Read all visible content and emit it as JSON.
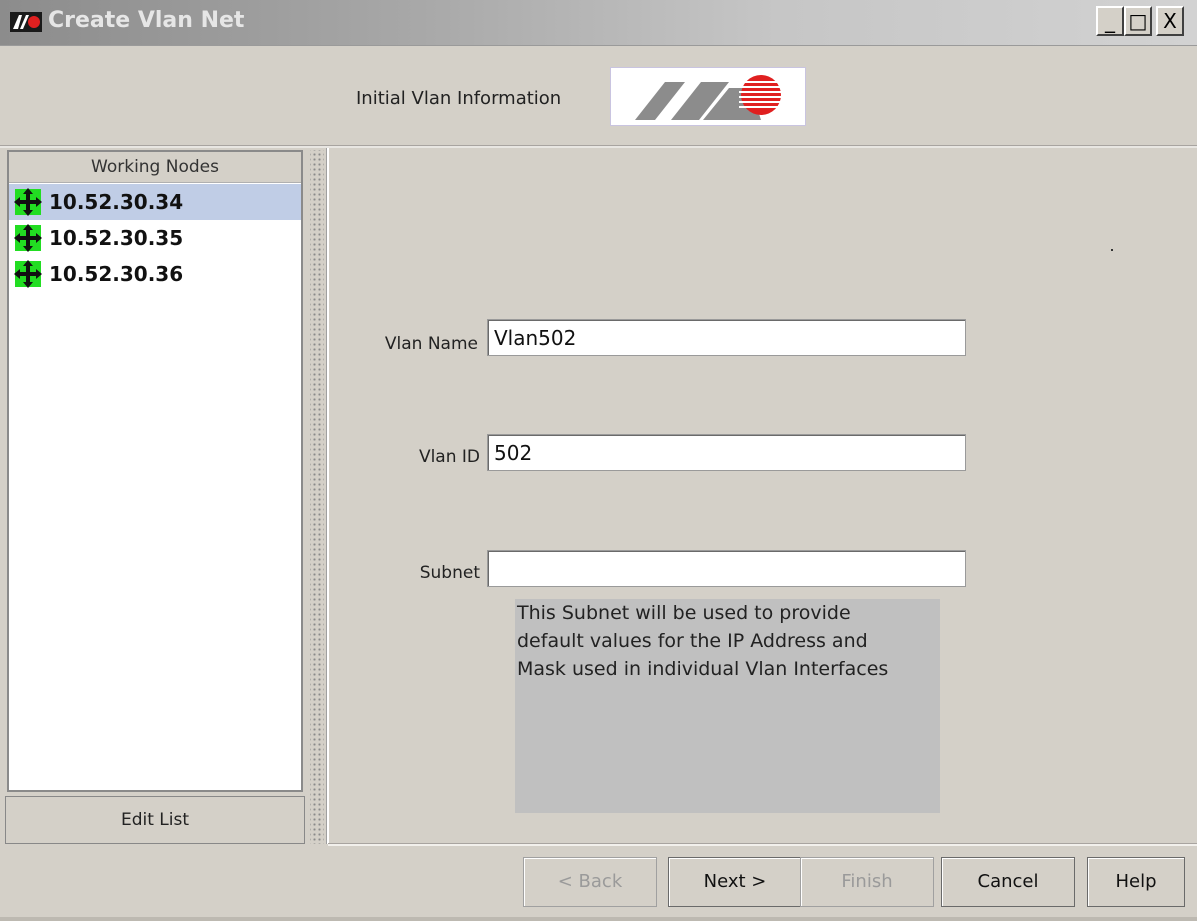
{
  "window": {
    "title": "Create Vlan Net",
    "controls": {
      "minimize": "_",
      "maximize": "□",
      "close": "X"
    }
  },
  "header": {
    "label": "Initial Vlan Information",
    "logo": "ATI"
  },
  "nodes_panel": {
    "header": "Working Nodes",
    "items": [
      {
        "label": "10.52.30.34",
        "selected": true,
        "icon": "network-node-icon"
      },
      {
        "label": "10.52.30.35",
        "selected": false,
        "icon": "network-node-icon"
      },
      {
        "label": "10.52.30.36",
        "selected": false,
        "icon": "network-node-icon"
      }
    ],
    "edit_button": "Edit List"
  },
  "form": {
    "vlan_name": {
      "label": "Vlan Name",
      "value": "Vlan502"
    },
    "vlan_id": {
      "label": "Vlan ID",
      "value": "502"
    },
    "subnet": {
      "label": "Subnet",
      "value": ""
    },
    "help_lines": [
      "This Subnet will be used to provide",
      "default values for the IP Address and",
      "Mask used in individual Vlan Interfaces"
    ]
  },
  "buttons": {
    "back": "< Back",
    "next": "Next >",
    "finish": "Finish",
    "cancel": "Cancel",
    "help": "Help"
  },
  "colors": {
    "window_bg": "#d4d0c8",
    "selection": "#c0cde6",
    "node_icon": "#22dd22",
    "logo_gray": "#8c8c8c",
    "logo_red": "#e02020"
  }
}
